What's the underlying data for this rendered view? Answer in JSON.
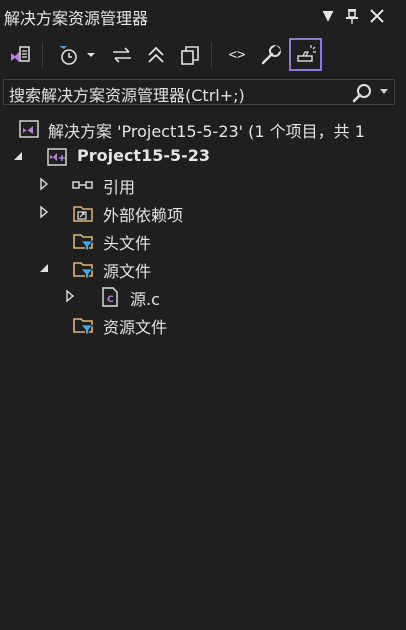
{
  "panel": {
    "title": "解决方案资源管理器",
    "dropdown_symbol": "▾",
    "pin_symbol": "📌",
    "close_symbol": "✕"
  },
  "toolbar": {
    "sync_tooltip": "",
    "code_symbol": "<>"
  },
  "search": {
    "placeholder": "搜索解决方案资源管理器(Ctrl+;)"
  },
  "tree": {
    "solution_label": "解决方案 'Project15-5-23' (1 个项目，共 1",
    "project_label": "Project15-5-23",
    "references_label": "引用",
    "external_deps_label": "外部依赖项",
    "header_files_label": "头文件",
    "source_files_label": "源文件",
    "source_c_label": "源.c",
    "resource_files_label": "资源文件"
  },
  "colors": {
    "background": "#1f1f1f",
    "accent": "#8f7bd6",
    "folder": "#dcb67a",
    "filter": "#3ea8e8",
    "vs_purple": "#b180d7"
  }
}
